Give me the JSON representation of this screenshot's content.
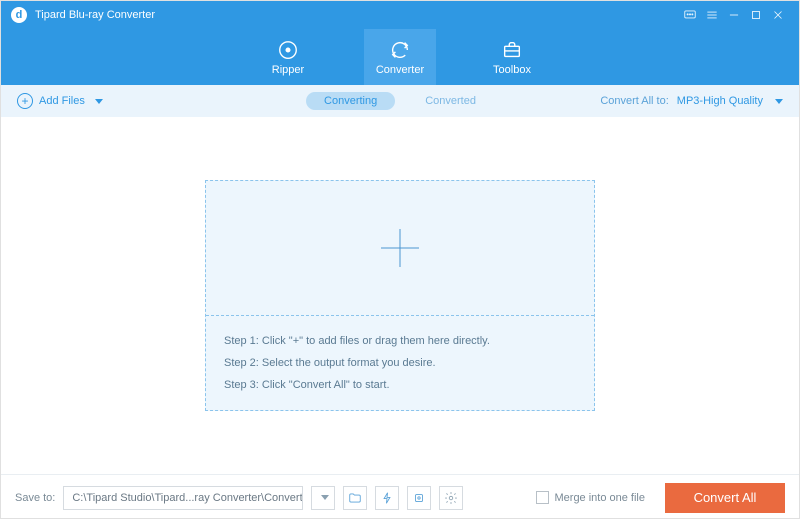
{
  "titlebar": {
    "app_name": "Tipard Blu-ray Converter"
  },
  "nav": {
    "ripper": "Ripper",
    "converter": "Converter",
    "toolbox": "Toolbox"
  },
  "toolbar": {
    "add_files": "Add Files",
    "tab_converting": "Converting",
    "tab_converted": "Converted",
    "convert_all_label": "Convert All to:",
    "format": "MP3-High Quality"
  },
  "dropzone": {
    "step1": "Step 1: Click \"+\" to add files or drag them here directly.",
    "step2": "Step 2: Select the output format you desire.",
    "step3": "Step 3: Click \"Convert All\" to start."
  },
  "footer": {
    "save_label": "Save to:",
    "save_path": "C:\\Tipard Studio\\Tipard...ray Converter\\Converted",
    "merge_label": "Merge into one file",
    "convert_button": "Convert All"
  }
}
